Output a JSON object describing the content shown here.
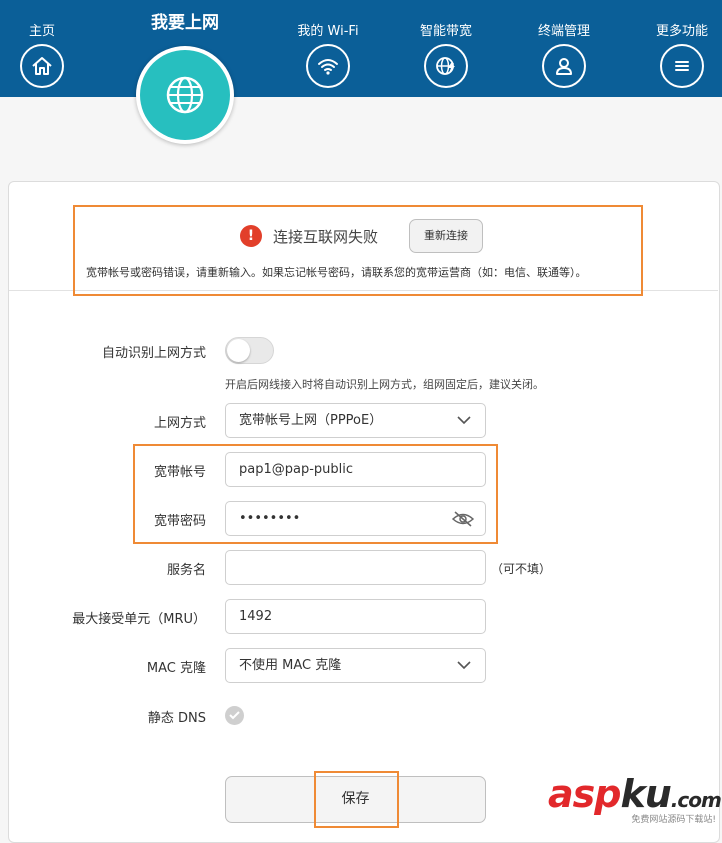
{
  "nav": {
    "items": [
      {
        "label": "主页",
        "icon": "home-icon"
      },
      {
        "label": "我的 Wi-Fi",
        "icon": "wifi-icon"
      },
      {
        "label": "智能带宽",
        "icon": "bandwidth-globe-icon"
      },
      {
        "label": "终端管理",
        "icon": "user-icon"
      },
      {
        "label": "更多功能",
        "icon": "menu-icon"
      }
    ],
    "active": {
      "label": "我要上网",
      "icon": "globe-icon"
    }
  },
  "colors": {
    "header": "#0b5f98",
    "active": "#27bfbf",
    "highlight": "#ef8a35",
    "error": "#e23f2a"
  },
  "alert": {
    "title": "连接互联网失败",
    "reconnect_label": "重新连接",
    "message": "宽带帐号或密码错误，请重新输入。如果忘记帐号密码，请联系您的宽带运营商（如：电信、联通等）。",
    "icon_glyph": "!"
  },
  "form": {
    "auto_detect": {
      "label": "自动识别上网方式",
      "enabled": false,
      "hint": "开启后网线接入时将自动识别上网方式，组网固定后，建议关闭。"
    },
    "mode": {
      "label": "上网方式",
      "value": "宽带帐号上网（PPPoE）"
    },
    "account": {
      "label": "宽带帐号",
      "value": "pap1@pap-public"
    },
    "password": {
      "label": "宽带密码",
      "value": "••••••••"
    },
    "service": {
      "label": "服务名",
      "value": "",
      "note": "（可不填）"
    },
    "mru": {
      "label": "最大接受单元（MRU）",
      "value": "1492"
    },
    "mac": {
      "label": "MAC 克隆",
      "value": "不使用 MAC 克隆"
    },
    "dns": {
      "label": "静态 DNS",
      "checked": true
    },
    "save_label": "保存"
  },
  "watermark": {
    "brand_a": "asp",
    "brand_b": "ku",
    "brand_c": ".com",
    "sub": "免费网站源码下载站!"
  }
}
